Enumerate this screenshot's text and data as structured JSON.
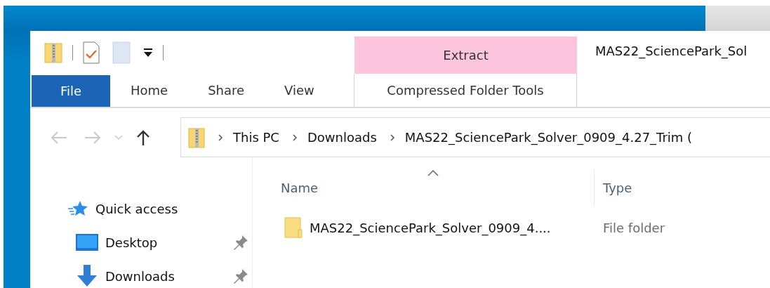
{
  "window": {
    "title": "MAS22_SciencePark_Sol"
  },
  "context_group": {
    "label": "Extract"
  },
  "tabs": [
    {
      "label": "File",
      "kind": "file"
    },
    {
      "label": "Home",
      "kind": "tab"
    },
    {
      "label": "Share",
      "kind": "tab"
    },
    {
      "label": "View",
      "kind": "tab"
    },
    {
      "label": "Compressed Folder Tools",
      "kind": "context"
    }
  ],
  "nav_buttons": [
    {
      "kind": "back",
      "disabled": true
    },
    {
      "kind": "forward",
      "disabled": true
    },
    {
      "kind": "recent",
      "disabled": true
    },
    {
      "kind": "up",
      "disabled": false
    }
  ],
  "breadcrumb": [
    "This PC",
    "Downloads",
    "MAS22_SciencePark_Solver_0909_4.27_Trim ("
  ],
  "sidebar": {
    "items": [
      {
        "label": "Quick access",
        "kind": "quick-access",
        "pinned": false
      },
      {
        "label": "Desktop",
        "kind": "desktop",
        "pinned": true
      },
      {
        "label": "Downloads",
        "kind": "downloads",
        "pinned": true
      }
    ]
  },
  "table": {
    "columns": [
      {
        "label": "Name",
        "sorted": true
      },
      {
        "label": "Type",
        "sorted": false
      }
    ],
    "rows": [
      {
        "name": "MAS22_SciencePark_Solver_0909_4....",
        "type": "File folder"
      }
    ]
  }
}
